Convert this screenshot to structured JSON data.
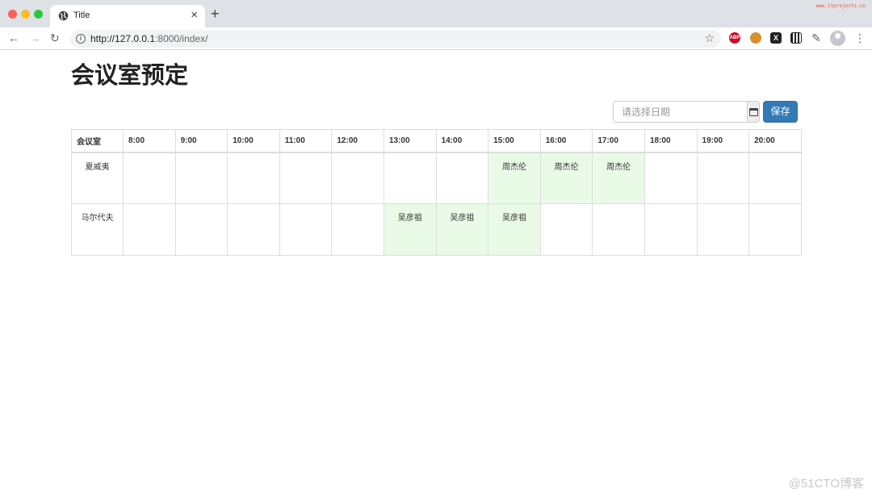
{
  "browser": {
    "tab_title": "Title",
    "tab_close": "×",
    "new_tab": "+",
    "top_watermark": "www.itprojects.cn",
    "url_host": "http://127.0.0.1",
    "url_path": ":8000/index/",
    "ext_abp": "ABP",
    "ext_x": "X"
  },
  "page": {
    "title": "会议室预定",
    "date_placeholder": "请选择日期",
    "save_label": "保存"
  },
  "table": {
    "headers": [
      "会议室",
      "8:00",
      "9:00",
      "10:00",
      "11:00",
      "12:00",
      "13:00",
      "14:00",
      "15:00",
      "16:00",
      "17:00",
      "18:00",
      "19:00",
      "20:00"
    ],
    "rows": [
      {
        "room": "夏威夷",
        "cells": [
          "",
          "",
          "",
          "",
          "",
          "",
          "",
          "周杰伦",
          "周杰伦",
          "周杰伦",
          "",
          "",
          ""
        ]
      },
      {
        "room": "马尔代夫",
        "cells": [
          "",
          "",
          "",
          "",
          "",
          "吴彦祖",
          "吴彦祖",
          "吴彦祖",
          "",
          "",
          "",
          "",
          ""
        ]
      }
    ],
    "booked_color": "#e9fbe7"
  },
  "watermark": "@51CTO博客"
}
